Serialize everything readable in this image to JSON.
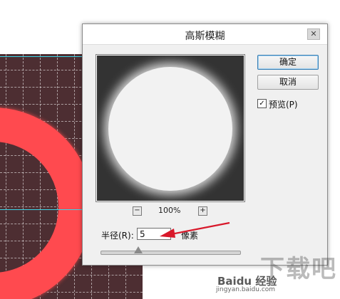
{
  "dialog": {
    "title": "高斯模糊",
    "close_glyph": "✕",
    "ok_label": "确定",
    "cancel_label": "取消",
    "preview_check_glyph": "✓",
    "preview_label": "预览(P)",
    "zoom": {
      "minus_glyph": "−",
      "plus_glyph": "+",
      "level": "100%"
    },
    "radius": {
      "label": "半径(R):",
      "value": "5",
      "unit": "像素",
      "slider_fraction": 0.27
    }
  },
  "watermark": {
    "big_text": "下载吧",
    "logo_text": "Baidu 经验",
    "url": "jingyan.baidu.com"
  },
  "colors": {
    "canvas_bg": "#4d2e32",
    "ring": "#ff4a4f",
    "guide": "#39d6e8",
    "arrow": "#d8182a"
  }
}
